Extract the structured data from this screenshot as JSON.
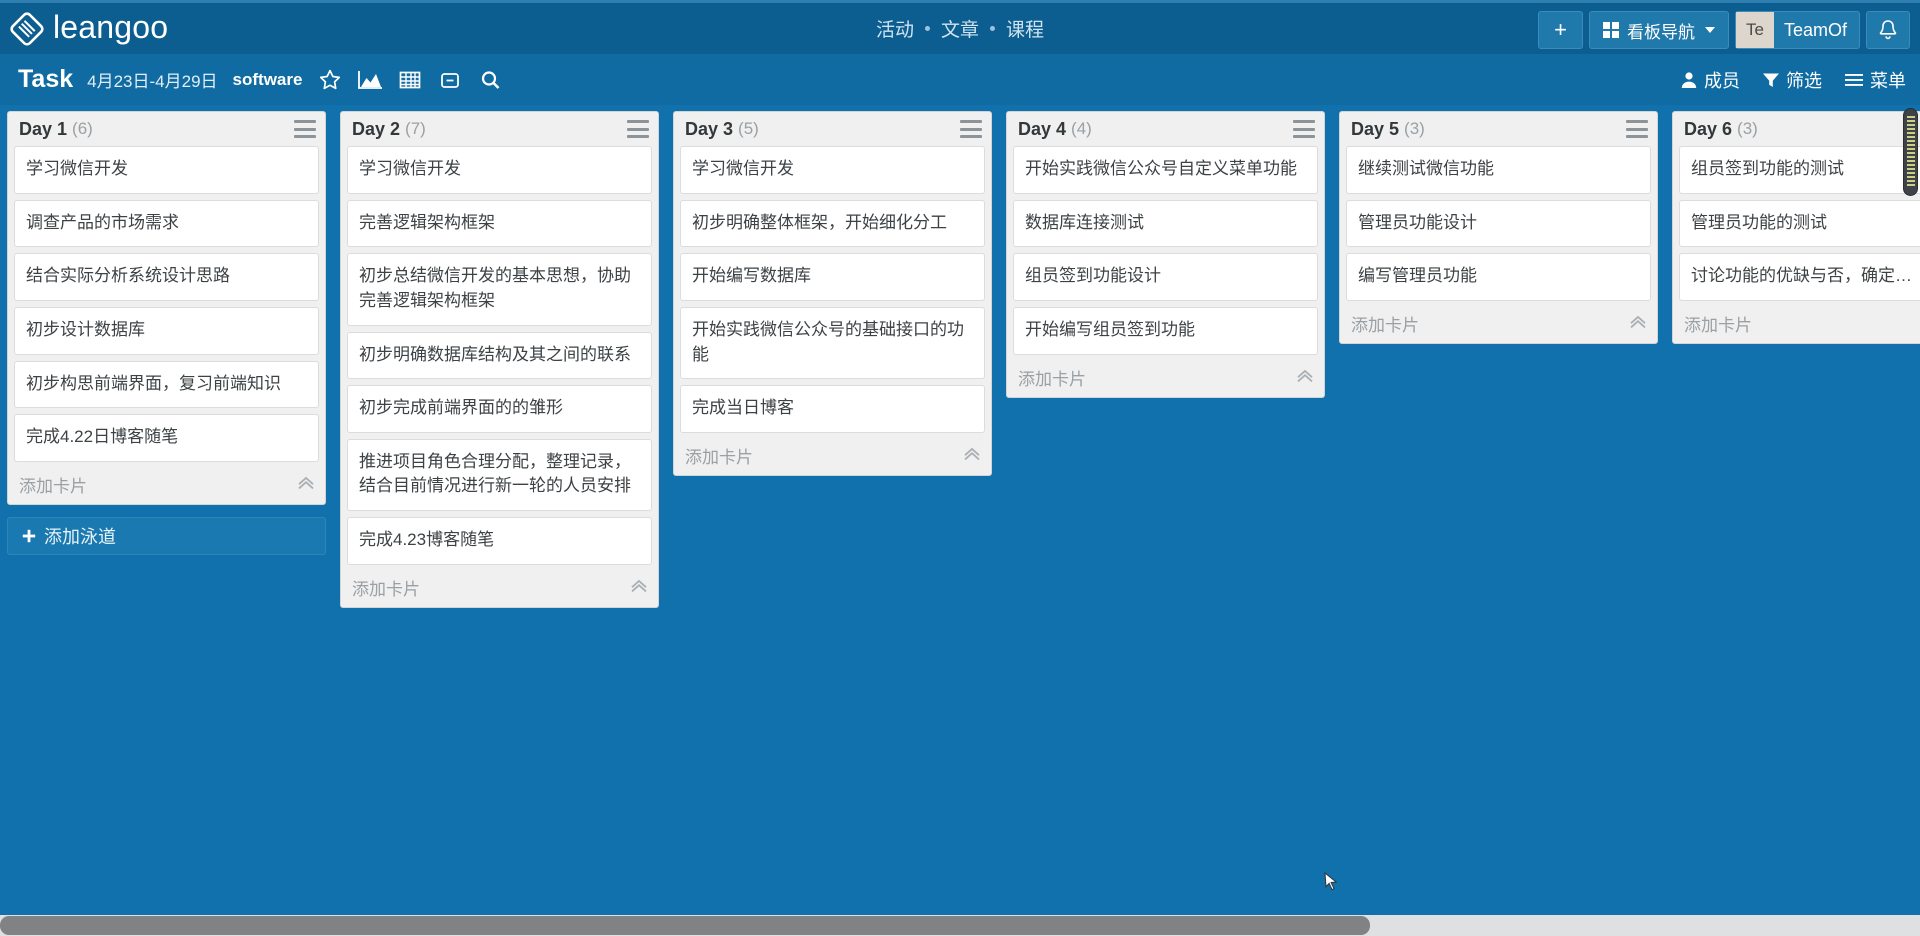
{
  "topnav": {
    "brand": "leangoo",
    "logo_icon": "leangoo-diamond-logo",
    "links": [
      "活动",
      "文章",
      "课程"
    ],
    "add_button": "+",
    "board_nav_label": "看板导航",
    "board_nav_icon": "grid-icon",
    "user_initials": "Te",
    "user_name": "TeamOf",
    "bell_icon": "bell-icon"
  },
  "toolbar": {
    "title": "Task",
    "date_range": "4月23日-4月29日",
    "tag": "software",
    "icons": [
      "star-icon",
      "area-chart-icon",
      "table-grid-icon",
      "minus-box-icon",
      "search-icon"
    ],
    "actions": [
      {
        "label": "成员",
        "icon": "user-icon"
      },
      {
        "label": "筛选",
        "icon": "filter-icon"
      },
      {
        "label": "菜单",
        "icon": "hamburger-icon"
      }
    ]
  },
  "board": {
    "add_card_label": "添加卡片",
    "collapse_icon": "chevron-up-double-icon",
    "list_menu_icon": "hamburger-icon",
    "add_swimlane_label": "添加泳道",
    "add_swimlane_icon": "plus-icon",
    "lists": [
      {
        "title": "Day 1",
        "count": "(6)",
        "cards": [
          "学习微信开发",
          "调查产品的市场需求",
          "结合实际分析系统设计思路",
          "初步设计数据库",
          "初步构思前端界面，复习前端知识",
          "完成4.22日博客随笔"
        ]
      },
      {
        "title": "Day 2",
        "count": "(7)",
        "cards": [
          "学习微信开发",
          "完善逻辑架构框架",
          "初步总结微信开发的基本思想，协助完善逻辑架构框架",
          "初步明确数据库结构及其之间的联系",
          "初步完成前端界面的的雏形",
          "推进项目角色合理分配，整理记录，结合目前情况进行新一轮的人员安排",
          "完成4.23博客随笔"
        ]
      },
      {
        "title": "Day 3",
        "count": "(5)",
        "cards": [
          "学习微信开发",
          "初步明确整体框架，开始细化分工",
          "开始编写数据库",
          "开始实践微信公众号的基础接口的功能",
          "完成当日博客"
        ]
      },
      {
        "title": "Day 4",
        "count": "(4)",
        "cards": [
          "开始实践微信公众号自定义菜单功能",
          "数据库连接测试",
          "组员签到功能设计",
          "开始编写组员签到功能"
        ]
      },
      {
        "title": "Day 5",
        "count": "(3)",
        "cards": [
          "继续测试微信功能",
          "管理员功能设计",
          "编写管理员功能"
        ]
      },
      {
        "title": "Day 6",
        "count": "(3)",
        "cards": [
          "组员签到功能的测试",
          "管理员功能的测试",
          "讨论功能的优缺与否，确定…"
        ]
      }
    ]
  },
  "scrollbars": {
    "horizontal_thumb_name": "horizontal-scrollbar-thumb",
    "vertical_thumb_name": "vertical-scrollbar-thumb"
  }
}
